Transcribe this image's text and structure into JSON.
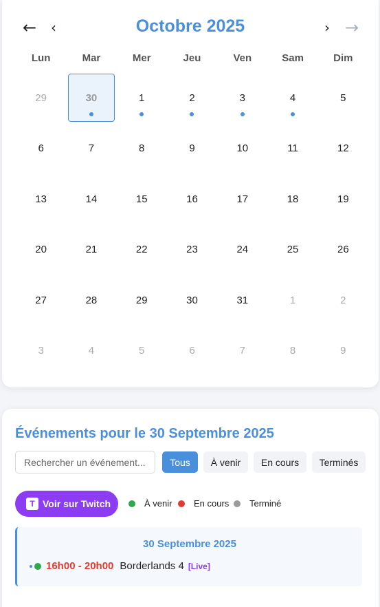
{
  "calendar": {
    "title": "Octobre 2025",
    "nav": {
      "prev_year": "←",
      "prev_month": "‹",
      "next_month": "›",
      "next_year": "→"
    },
    "weekdays": [
      "Lun",
      "Mar",
      "Mer",
      "Jeu",
      "Ven",
      "Sam",
      "Dim"
    ],
    "days": [
      {
        "n": "29",
        "muted": true
      },
      {
        "n": "30",
        "muted": true,
        "selected": true,
        "dot": true
      },
      {
        "n": "1",
        "dot": true
      },
      {
        "n": "2",
        "dot": true
      },
      {
        "n": "3",
        "dot": true
      },
      {
        "n": "4",
        "dot": true
      },
      {
        "n": "5"
      },
      {
        "n": "6"
      },
      {
        "n": "7"
      },
      {
        "n": "8"
      },
      {
        "n": "9"
      },
      {
        "n": "10"
      },
      {
        "n": "11"
      },
      {
        "n": "12"
      },
      {
        "n": "13"
      },
      {
        "n": "14"
      },
      {
        "n": "15"
      },
      {
        "n": "16"
      },
      {
        "n": "17"
      },
      {
        "n": "18"
      },
      {
        "n": "19"
      },
      {
        "n": "20"
      },
      {
        "n": "21"
      },
      {
        "n": "22"
      },
      {
        "n": "23"
      },
      {
        "n": "24"
      },
      {
        "n": "25"
      },
      {
        "n": "26"
      },
      {
        "n": "27"
      },
      {
        "n": "28"
      },
      {
        "n": "29"
      },
      {
        "n": "30"
      },
      {
        "n": "31"
      },
      {
        "n": "1",
        "muted": true
      },
      {
        "n": "2",
        "muted": true
      },
      {
        "n": "3",
        "muted": true
      },
      {
        "n": "4",
        "muted": true
      },
      {
        "n": "5",
        "muted": true
      },
      {
        "n": "6",
        "muted": true
      },
      {
        "n": "7",
        "muted": true
      },
      {
        "n": "8",
        "muted": true
      },
      {
        "n": "9",
        "muted": true
      }
    ]
  },
  "events": {
    "title": "Événements pour le 30 Septembre 2025",
    "search_placeholder": "Rechercher un événement...",
    "filters": [
      "Tous",
      "À venir",
      "En cours",
      "Terminés"
    ],
    "active_filter": "Tous",
    "twitch": {
      "icon_letter": "T",
      "label": "Voir sur Twitch"
    },
    "legend": {
      "upcoming": "À venir",
      "ongoing": "En cours",
      "finished": "Terminé"
    },
    "legend_colors": {
      "upcoming": "#2ea84a",
      "ongoing": "#e03b2e",
      "finished": "#9a9a9a"
    },
    "panel": {
      "date": "30 Septembre 2025",
      "items": [
        {
          "time": "16h00 - 20h00",
          "name": "Borderlands 4",
          "tag": "[Live]",
          "status": "upcoming"
        }
      ]
    }
  }
}
